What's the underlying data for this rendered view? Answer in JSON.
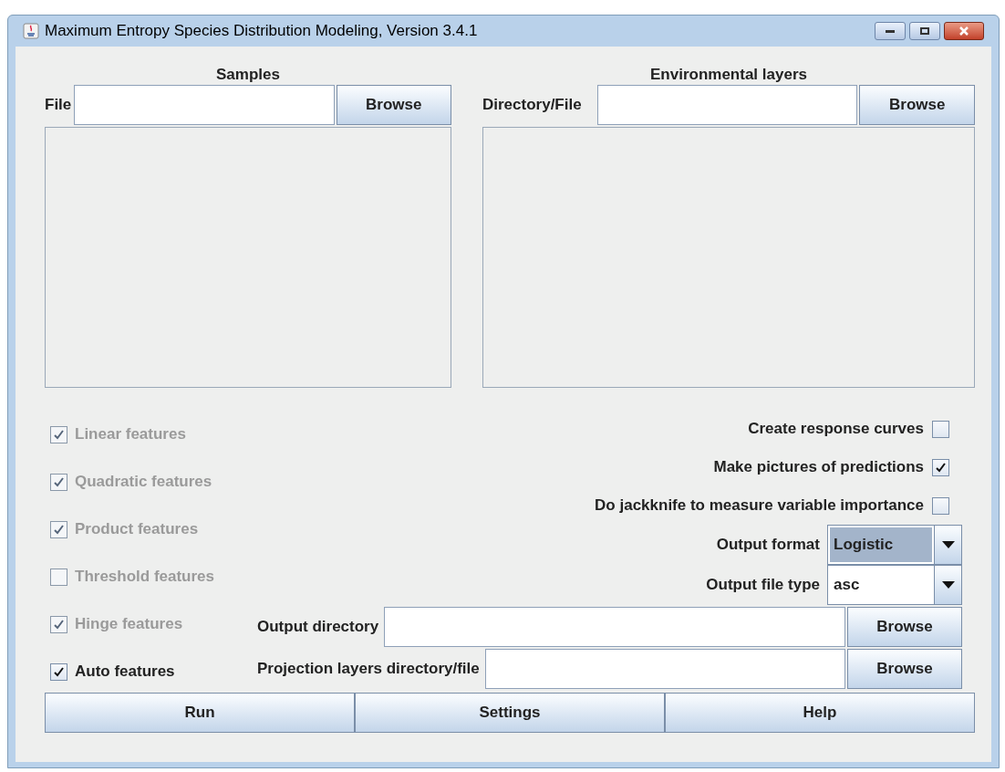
{
  "window": {
    "title": "Maximum Entropy Species Distribution Modeling, Version 3.4.1"
  },
  "samples": {
    "heading": "Samples",
    "label": "File",
    "browse": "Browse"
  },
  "environmental_layers": {
    "heading": "Environmental layers",
    "label": "Directory/File",
    "browse": "Browse"
  },
  "features": [
    {
      "label": "Linear features",
      "checked": true,
      "disabled": true
    },
    {
      "label": "Quadratic features",
      "checked": true,
      "disabled": true
    },
    {
      "label": "Product features",
      "checked": true,
      "disabled": true
    },
    {
      "label": "Threshold features",
      "checked": false,
      "disabled": true
    },
    {
      "label": "Hinge features",
      "checked": true,
      "disabled": true
    },
    {
      "label": "Auto features",
      "checked": true,
      "disabled": false
    }
  ],
  "options": [
    {
      "label": "Create response curves",
      "checked": false
    },
    {
      "label": "Make pictures of predictions",
      "checked": true
    },
    {
      "label": "Do jackknife to measure variable importance",
      "checked": false
    }
  ],
  "dropdowns": [
    {
      "label": "Output format",
      "value": "Logistic",
      "focused": true
    },
    {
      "label": "Output file type",
      "value": "asc",
      "focused": false
    }
  ],
  "paths": [
    {
      "label": "Output directory",
      "browse": "Browse"
    },
    {
      "label": "Projection layers directory/file",
      "browse": "Browse"
    }
  ],
  "buttons": [
    "Run",
    "Settings",
    "Help"
  ]
}
